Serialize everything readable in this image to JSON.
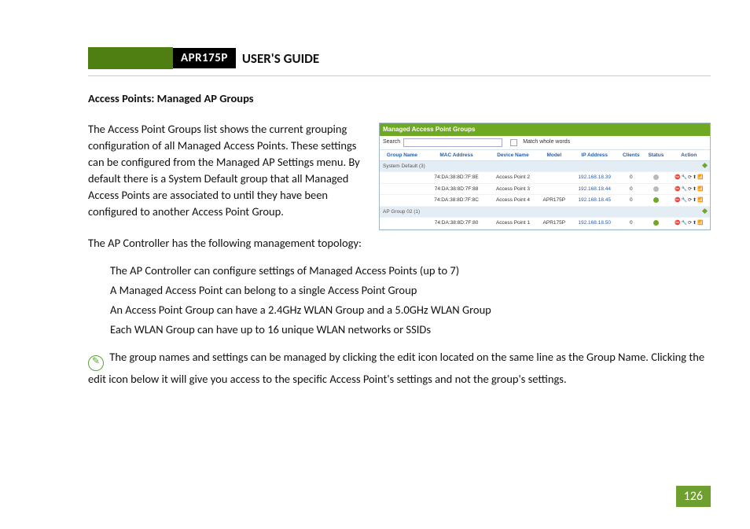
{
  "header": {
    "model": "APR175P",
    "title": "USER'S GUIDE"
  },
  "section_title": "Access Points: Managed AP Groups",
  "para1": "The Access Point Groups list shows the current grouping configuration of all Managed Access Points. These settings can be configured from the Managed AP Settings menu.  By default there is a System Default group that all Managed Access Points are associated to until they have been configured to another Access Point Group.",
  "para2": "The AP Controller has the following management topology:",
  "topology": [
    "The AP Controller can configure settings of Managed Access Points (up to 7)",
    "A Managed Access Point can belong to a single Access Point Group",
    "An Access Point Group can have a 2.4GHz WLAN Group and a 5.0GHz WLAN Group",
    "Each WLAN Group can have up to 16 unique WLAN networks or SSIDs"
  ],
  "tip": "The group names and settings can be managed by clicking the edit icon located on the same line as the Group Name.  Clicking the edit icon below it will give you access to the specific Access Point's settings and not the group's settings.",
  "page_number": "126",
  "shot": {
    "title": "Managed Access Point Groups",
    "search_label": "Search",
    "match_label": "Match whole words",
    "headers": {
      "c1": "Group Name",
      "c2": "MAC Address",
      "c3": "Device Name",
      "c4": "Model",
      "c5": "IP Address",
      "c6": "Clients",
      "c7": "Status",
      "c8": "Action"
    },
    "group1": "System Default (3)",
    "group2": "AP Group 02 (1)",
    "rows": [
      {
        "mac": "74:DA:38:8D:7F:8E",
        "name": "Access Point 2",
        "model": "",
        "ip": "192.168.18.39",
        "clients": "0",
        "status": "gr"
      },
      {
        "mac": "74:DA:38:8D:7F:88",
        "name": "Access Point 3",
        "model": "",
        "ip": "192.168.18.44",
        "clients": "0",
        "status": "gr"
      },
      {
        "mac": "74:DA:38:8D:7F:8C",
        "name": "Access Point 4",
        "model": "APR175P",
        "ip": "192.168.18.45",
        "clients": "0",
        "status": "g"
      }
    ],
    "rows2": [
      {
        "mac": "74:DA:38:8D:7F:80",
        "name": "Access Point 1",
        "model": "APR175P",
        "ip": "192.168.18.50",
        "clients": "0",
        "status": "g"
      }
    ]
  }
}
